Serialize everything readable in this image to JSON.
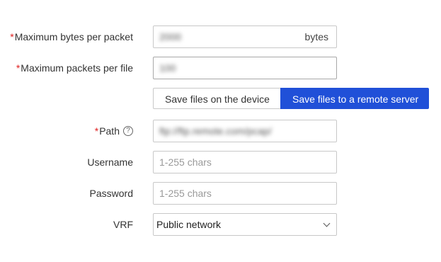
{
  "form": {
    "max_bytes": {
      "required_mark": "*",
      "label": "Maximum bytes per packet",
      "value": "2000",
      "unit": "bytes"
    },
    "max_packets": {
      "required_mark": "*",
      "label": "Maximum packets per file",
      "value": "100"
    },
    "save_mode": {
      "options": [
        "Save files on the device",
        "Save files to a remote server"
      ],
      "selected": "Save files to a remote server"
    },
    "path": {
      "required_mark": "*",
      "label": "Path",
      "help_icon": "?",
      "value": "ftp://ftp.remote.com/pcap/"
    },
    "username": {
      "label": "Username",
      "placeholder": "1-255 chars"
    },
    "password": {
      "label": "Password",
      "placeholder": "1-255 chars"
    },
    "vrf": {
      "label": "VRF",
      "value": "Public network"
    }
  },
  "colors": {
    "accent": "#2050d8",
    "required": "#e02020"
  }
}
